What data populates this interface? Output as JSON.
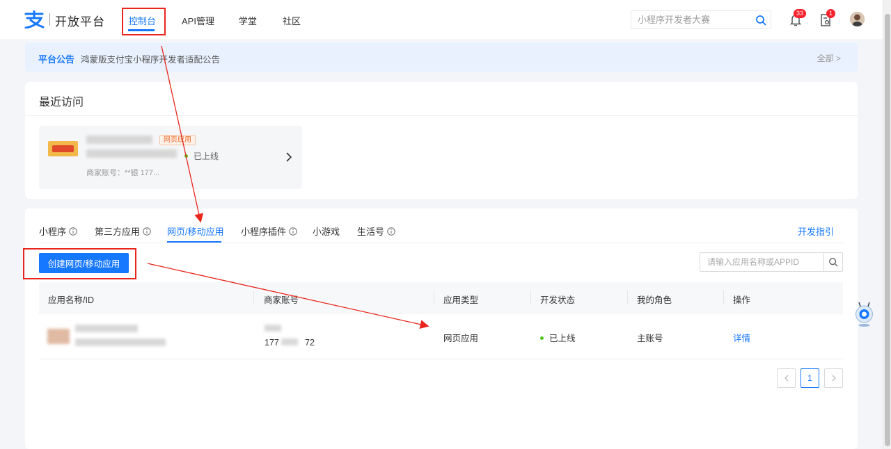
{
  "header": {
    "logo_text": "开放平台",
    "nav": [
      {
        "label": "控制台",
        "active": true
      },
      {
        "label": "API管理",
        "active": false
      },
      {
        "label": "学堂",
        "active": false
      },
      {
        "label": "社区",
        "active": false
      }
    ],
    "search_placeholder": "小程序开发者大赛",
    "notifications_count": "33",
    "tasks_count": "1"
  },
  "announcement": {
    "tag": "平台公告",
    "text": "鸿蒙版支付宝小程序开发者适配公告",
    "all_link": "全部 >"
  },
  "recent": {
    "title": "最近访问",
    "item": {
      "type_badge": "网页应用",
      "status": "已上线",
      "merchant": "商家账号：**银 177..."
    }
  },
  "apps": {
    "tabs": [
      {
        "label": "小程序",
        "info": true,
        "active": false
      },
      {
        "label": "第三方应用",
        "info": true,
        "active": false
      },
      {
        "label": "网页/移动应用",
        "info": false,
        "active": true
      },
      {
        "label": "小程序插件",
        "info": true,
        "active": false
      },
      {
        "label": "小游戏",
        "info": false,
        "active": false
      },
      {
        "label": "生活号",
        "info": true,
        "active": false
      }
    ],
    "guide_link": "开发指引",
    "create_button": "创建网页/移动应用",
    "search_placeholder": "请输入应用名称或APPID",
    "columns": [
      "应用名称/ID",
      "商家账号",
      "应用类型",
      "开发状态",
      "我的角色",
      "操作"
    ],
    "rows": [
      {
        "merchant_partial": "177",
        "merchant_tail": "72",
        "type": "网页应用",
        "status": "已上线",
        "role": "主账号",
        "action": "详情"
      }
    ],
    "pagination": {
      "current": "1"
    }
  },
  "colors": {
    "accent": "#1677ff",
    "annotation": "#e8261c",
    "online": "#52c41a"
  }
}
